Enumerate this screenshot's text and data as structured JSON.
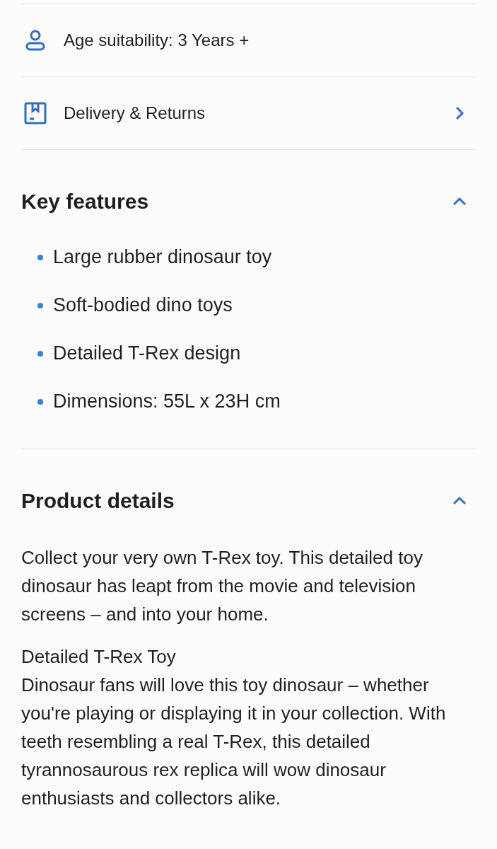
{
  "info_rows": [
    {
      "kind": "age",
      "label": "Age suitability: 3 Years +",
      "has_link": false
    },
    {
      "kind": "delivery",
      "label": "Delivery & Returns",
      "has_link": true
    }
  ],
  "key_features": {
    "title": "Key features",
    "expanded": true,
    "items": [
      "Large rubber dinosaur toy",
      "Soft-bodied dino toys",
      "Detailed T-Rex design",
      "Dimensions: 55L x 23H cm"
    ]
  },
  "product_details": {
    "title": "Product details",
    "expanded": true,
    "intro": "Collect your very own T-Rex toy. This detailed toy dinosaur has leapt from the movie and television screens – and into your home.",
    "subheading": "Detailed T-Rex Toy",
    "body": "Dinosaur fans will love this toy dinosaur – whether you're playing or displaying it in your collection. With teeth resembling a real T-Rex, this detailed tyrannosaurous rex replica will wow dinosaur enthusiasts and collectors alike."
  }
}
